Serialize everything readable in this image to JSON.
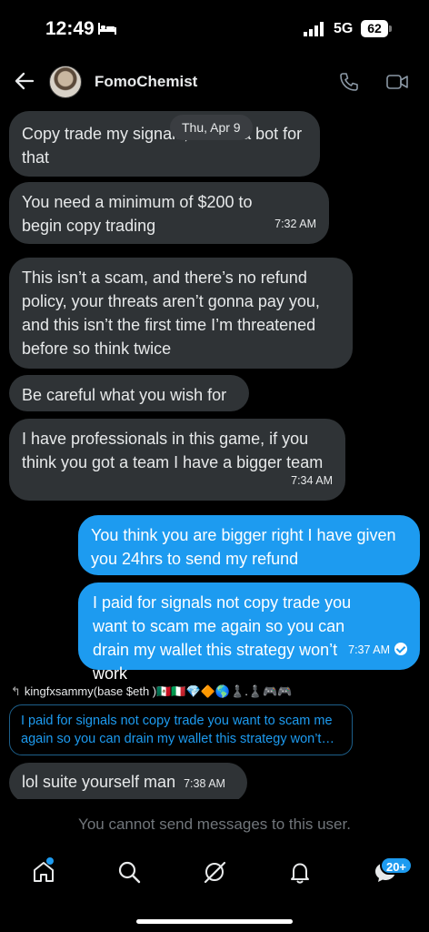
{
  "status_bar": {
    "time": "12:49",
    "network": "5G",
    "battery": "62"
  },
  "header": {
    "contact_name": "FomoChemist"
  },
  "date_pill": "Thu, Apr 9",
  "messages": [
    {
      "from": "them",
      "text": "Copy trade my signals, I have a bot for that",
      "time": ""
    },
    {
      "from": "them",
      "text": "You need a minimum of $200 to begin copy trading",
      "time": "7:32 AM"
    },
    {
      "from": "them",
      "text": "This isn’t a scam, and there’s no refund policy, your threats aren’t gonna pay you, and this isn’t the first time I’m threatened before so think twice",
      "time": ""
    },
    {
      "from": "them",
      "text": "Be careful what you wish for",
      "time": ""
    },
    {
      "from": "them",
      "text": "I have professionals in this game, if you think you got a team I have a bigger team",
      "time": "7:34 AM"
    },
    {
      "from": "me",
      "text": "You think you are bigger right I have given you 24hrs to send my refund",
      "time": ""
    },
    {
      "from": "me",
      "text": "I paid for signals not copy trade you want to scam me again so you can drain my wallet this strategy won’t work",
      "time": "7:37 AM"
    }
  ],
  "reply": {
    "author": "kingfxsammy(base $eth )🇲🇽🇮🇹💎🔶🌎♟️.♟️🎮🎮",
    "quoted": "I paid for signals not copy trade you want to scam me again so you can drain my wallet this strategy won’t work"
  },
  "last_message": {
    "text": "lol suite yourself man",
    "time": "7:38 AM"
  },
  "composer_notice": "You cannot send messages to this user.",
  "nav": {
    "messages_badge": "20+"
  },
  "colors": {
    "accent": "#1d9bf0",
    "received_bubble": "#2f3336",
    "background": "#000000",
    "muted": "#71767b"
  }
}
